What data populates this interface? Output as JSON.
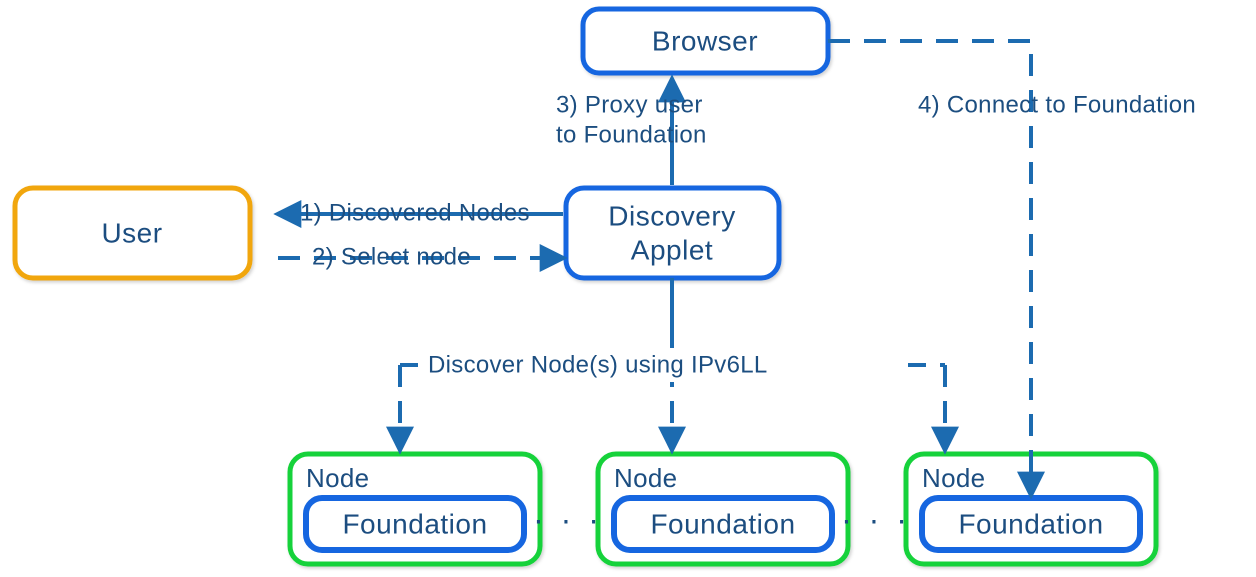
{
  "boxes": {
    "user": "User",
    "browser": "Browser",
    "discovery_line1": "Discovery",
    "discovery_line2": "Applet",
    "node": "Node",
    "foundation": "Foundation"
  },
  "edges": {
    "step1": "1) Discovered Nodes",
    "step2": "2) Select node",
    "step3_line1": "3) Proxy user",
    "step3_line2": "to Foundation",
    "step4": "4) Connect to Foundation",
    "discover": "Discover Node(s) using IPv6LL"
  },
  "dots": "· · ·",
  "colors": {
    "blue": "#1566e0",
    "dark": "#1c4e80",
    "orange": "#f1a60f",
    "green": "#19d23b"
  }
}
